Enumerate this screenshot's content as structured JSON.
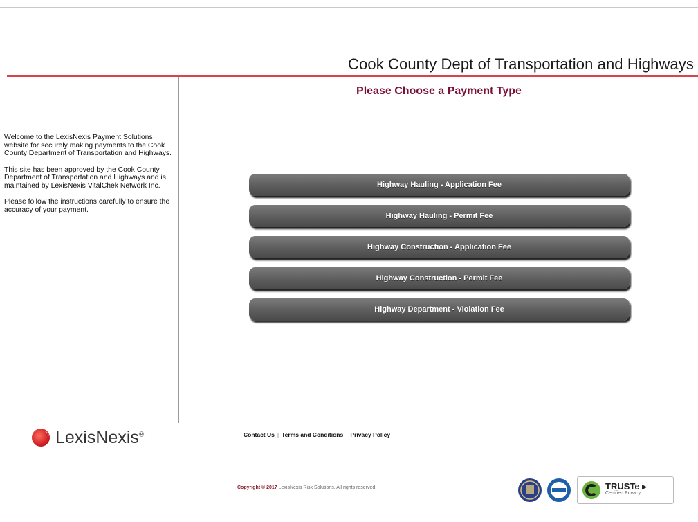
{
  "header": {
    "title": "Cook County Dept of Transportation and Highways"
  },
  "main": {
    "heading": "Please Choose a Payment Type",
    "buttons": [
      {
        "label": "Highway Hauling - Application Fee"
      },
      {
        "label": "Highway Hauling - Permit Fee"
      },
      {
        "label": "Highway Construction - Application Fee"
      },
      {
        "label": "Highway Construction - Permit Fee"
      },
      {
        "label": "Highway Department - Violation Fee"
      }
    ]
  },
  "sidebar": {
    "paragraphs": [
      "Welcome to the LexisNexis Payment Solutions website for securely making payments to the Cook County Department of Transportation and Highways.",
      "This site has been approved by the Cook County Department of Transportation and Highways and is maintained by LexisNexis VitalChek Network Inc.",
      "Please follow the instructions carefully to ensure the accuracy of your payment."
    ]
  },
  "footer": {
    "links": [
      "Contact Us",
      "Terms and Conditions",
      "Privacy Policy"
    ],
    "copyright_prefix": "Copyright © 2017",
    "copyright_rest": "LexisNexis Risk Solutions. All rights reserved.",
    "logo_text": "LexisNexis",
    "logo_mark": "®",
    "trust_title": "TRUSTe",
    "trust_arrow": "▸",
    "trust_sub": "Certified Privacy"
  },
  "colors": {
    "accent_red": "#d9434a",
    "heading": "#7a1038",
    "button": "#5d5d5d"
  }
}
